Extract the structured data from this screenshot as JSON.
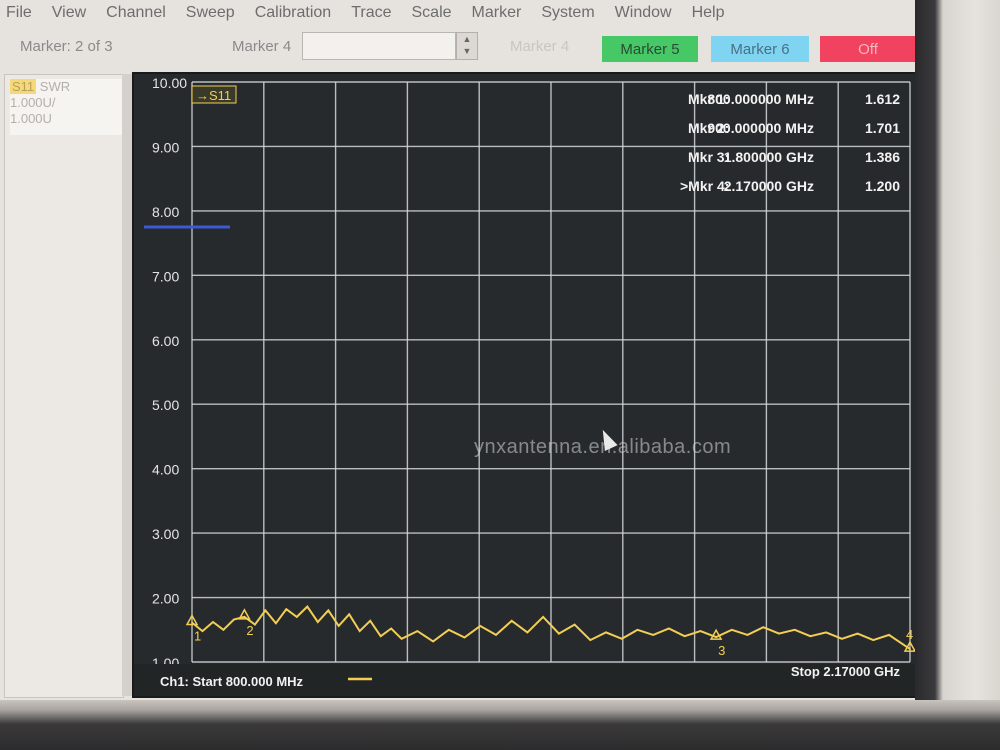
{
  "menu": [
    "File",
    "View",
    "Channel",
    "Sweep",
    "Calibration",
    "Trace",
    "Scale",
    "Marker",
    "System",
    "Window",
    "Help"
  ],
  "toolbar": {
    "marker_count": "Marker: 2 of 3",
    "marker_field_label": "Marker 4",
    "marker_field_value": "",
    "marker_disabled_label": "Marker 4",
    "btn_marker5": "Marker 5",
    "btn_marker6": "Marker 6",
    "btn_off": "Off"
  },
  "trace_panel": {
    "tag": "S11",
    "format": "SWR",
    "scale1": "1.000U/",
    "scale2": "1.000U"
  },
  "plot": {
    "trace_tag": "→S11",
    "channel_label": "Ch1: Start  800.000 MHz",
    "stop_label": "Stop  2.17000 GHz",
    "watermark": "ynxantenna.en.alibaba.com"
  },
  "markers": [
    {
      "label": "Mkr  1:",
      "freq": "800.000000 MHz",
      "value": "1.612"
    },
    {
      "label": "Mkr  2:",
      "freq": "900.000000 MHz",
      "value": "1.701"
    },
    {
      "label": "Mkr  3:",
      "freq": "1.800000 GHz",
      "value": "1.386"
    },
    {
      "label": ">Mkr  4:",
      "freq": "2.170000 GHz",
      "value": "1.200"
    }
  ],
  "colors": {
    "trace": "#f2ce54",
    "grid": "#d5d8dc",
    "background": "#272a2c",
    "marker5": "#46c866",
    "marker6": "#7fd4f2",
    "off": "#f1435f"
  },
  "chart_data": {
    "type": "line",
    "xlabel": "",
    "ylabel": "",
    "xlim": [
      800,
      2170
    ],
    "ylim": [
      1.0,
      10.0
    ],
    "y_ticks": [
      "1.00",
      "2.00",
      "3.00",
      "4.00",
      "5.00",
      "6.00",
      "7.00",
      "8.00",
      "9.00",
      "10.00"
    ],
    "series": [
      {
        "x": [
          800,
          820,
          840,
          860,
          880,
          900,
          920,
          940,
          960,
          980,
          1000,
          1020,
          1040,
          1060,
          1080,
          1100,
          1120,
          1140,
          1160,
          1180,
          1200,
          1230,
          1260,
          1290,
          1320,
          1350,
          1380,
          1410,
          1440,
          1470,
          1500,
          1530,
          1560,
          1590,
          1620,
          1650,
          1680,
          1710,
          1740,
          1770,
          1800,
          1830,
          1860,
          1890,
          1920,
          1950,
          1980,
          2010,
          2040,
          2070,
          2100,
          2130,
          2170
        ],
        "y": [
          1.612,
          1.48,
          1.62,
          1.5,
          1.66,
          1.701,
          1.58,
          1.8,
          1.6,
          1.82,
          1.7,
          1.86,
          1.62,
          1.8,
          1.56,
          1.74,
          1.48,
          1.64,
          1.4,
          1.52,
          1.36,
          1.48,
          1.32,
          1.5,
          1.38,
          1.56,
          1.42,
          1.64,
          1.46,
          1.7,
          1.44,
          1.58,
          1.34,
          1.46,
          1.36,
          1.5,
          1.42,
          1.52,
          1.4,
          1.48,
          1.386,
          1.5,
          1.42,
          1.54,
          1.44,
          1.5,
          1.4,
          1.46,
          1.36,
          1.44,
          1.34,
          1.42,
          1.2
        ]
      }
    ]
  }
}
